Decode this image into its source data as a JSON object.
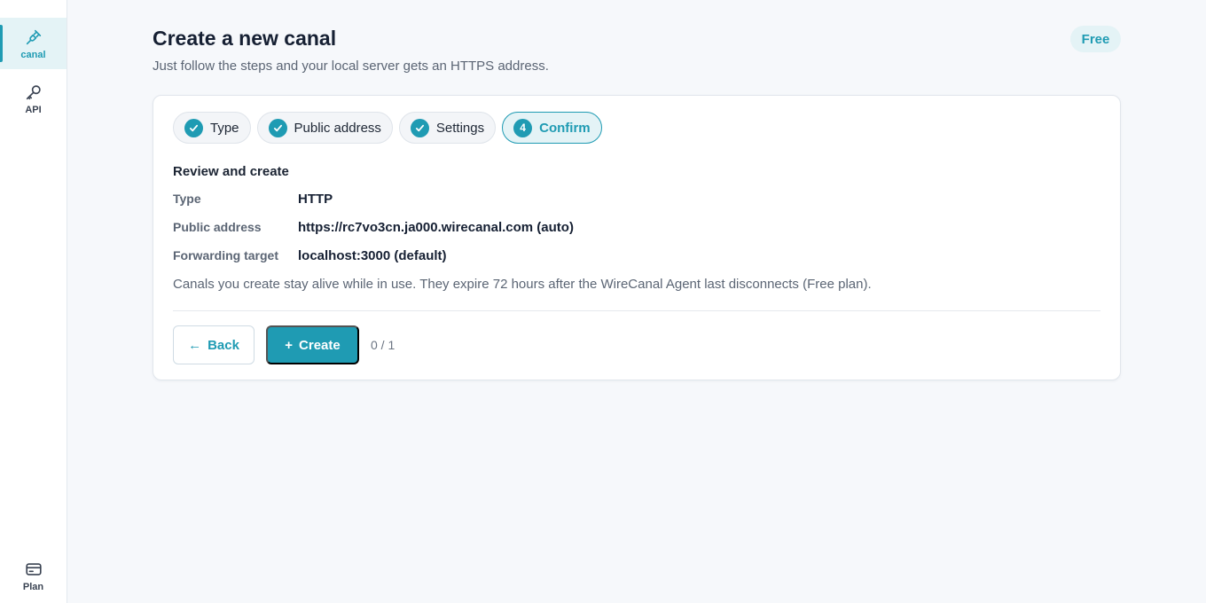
{
  "sidebar": {
    "items": [
      {
        "label": "canal",
        "icon": "plug-icon",
        "active": true
      },
      {
        "label": "API",
        "icon": "key-icon",
        "active": false
      }
    ],
    "bottom": {
      "label": "Plan",
      "icon": "credit-card-icon"
    }
  },
  "header": {
    "title": "Create a new canal",
    "subtitle": "Just follow the steps and your local server gets an HTTPS address.",
    "plan_badge": "Free"
  },
  "steps": [
    {
      "label": "Type",
      "state": "done"
    },
    {
      "label": "Public address",
      "state": "done"
    },
    {
      "label": "Settings",
      "state": "done"
    },
    {
      "label": "Confirm",
      "state": "current",
      "number": "4"
    }
  ],
  "review": {
    "title": "Review and create",
    "rows": [
      {
        "key": "Type",
        "value": "HTTP"
      },
      {
        "key": "Public address",
        "value": "https://rc7vo3cn.ja000.wirecanal.com (auto)"
      },
      {
        "key": "Forwarding target",
        "value": "localhost:3000 (default)"
      }
    ],
    "note": "Canals you create stay alive while in use. They expire 72 hours after the WireCanal Agent last disconnects (Free plan)."
  },
  "actions": {
    "back_icon": "←",
    "back_label": "Back",
    "create_icon": "+",
    "create_label": "Create",
    "counter": "0 / 1"
  },
  "colors": {
    "accent": "#1f9bb3",
    "accent_bg": "#e4f3f6",
    "background": "#f6f8fb"
  }
}
